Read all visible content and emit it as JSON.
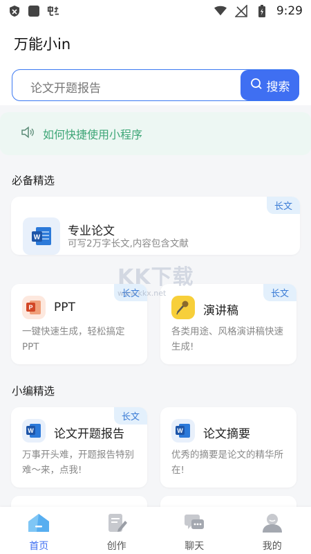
{
  "status_bar": {
    "time": "9:29"
  },
  "header": {
    "title": "万能小in"
  },
  "search": {
    "value": "论文开题报告",
    "button_label": "搜索"
  },
  "tip": {
    "text": "如何快捷使用小程序"
  },
  "section_featured": {
    "title": "必备精选",
    "cards": [
      {
        "title": "专业论文",
        "desc": "可写2万字长文,内容包含文献",
        "badge": "长文",
        "icon": "word-icon"
      },
      {
        "title": "PPT",
        "desc": "一键快速生成，轻松搞定PPT",
        "badge": "长文",
        "icon": "ppt-icon"
      },
      {
        "title": "演讲稿",
        "desc": "各类用途、风格演讲稿快速生成!",
        "badge": "长文",
        "icon": "microphone-icon"
      }
    ]
  },
  "section_editor": {
    "title": "小编精选",
    "cards": [
      {
        "title": "论文开题报告",
        "desc": "万事开头难，开题报告特别难～来，点我!",
        "badge": "长文",
        "icon": "word-icon"
      },
      {
        "title": "论文摘要",
        "desc": "优秀的摘要是论文的精华所在!",
        "icon": "word-icon"
      }
    ]
  },
  "tab_bar": {
    "tabs": [
      {
        "label": "首页",
        "icon": "home-icon",
        "active": true
      },
      {
        "label": "创作",
        "icon": "edit-icon",
        "active": false
      },
      {
        "label": "聊天",
        "icon": "chat-icon",
        "active": false
      },
      {
        "label": "我的",
        "icon": "profile-icon",
        "active": false
      }
    ]
  },
  "watermark": {
    "text": "KK下载",
    "subtext": "www.kkx.net"
  },
  "colors": {
    "accent": "#3f6ff2",
    "tip_green": "#3ea677",
    "badge_bg": "#e3f0fc"
  }
}
